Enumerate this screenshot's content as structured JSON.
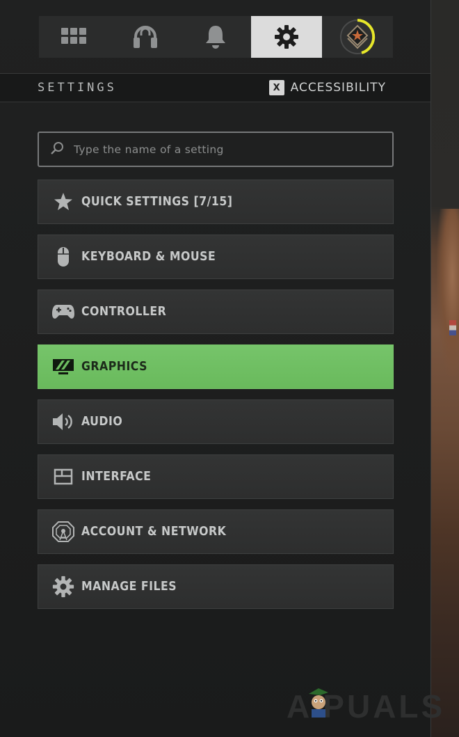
{
  "top_nav": {
    "items": [
      {
        "name": "grid-menu",
        "icon": "grid-icon"
      },
      {
        "name": "social",
        "icon": "headset-icon"
      },
      {
        "name": "notifications",
        "icon": "bell-icon"
      },
      {
        "name": "settings",
        "icon": "gear-icon",
        "active": true
      },
      {
        "name": "profile",
        "icon": "rank-badge-icon"
      }
    ]
  },
  "header": {
    "title": "SETTINGS",
    "accessibility_key": "X",
    "accessibility_label": "ACCESSIBILITY"
  },
  "search": {
    "placeholder": "Type the name of a setting",
    "value": ""
  },
  "menu": {
    "items": [
      {
        "label": "QUICK SETTINGS [7/15]",
        "icon": "star-icon"
      },
      {
        "label": "KEYBOARD & MOUSE",
        "icon": "mouse-icon"
      },
      {
        "label": "CONTROLLER",
        "icon": "gamepad-icon"
      },
      {
        "label": "GRAPHICS",
        "icon": "monitor-icon",
        "active": true
      },
      {
        "label": "AUDIO",
        "icon": "speaker-icon"
      },
      {
        "label": "INTERFACE",
        "icon": "layout-icon"
      },
      {
        "label": "ACCOUNT & NETWORK",
        "icon": "network-icon"
      },
      {
        "label": "MANAGE FILES",
        "icon": "gear-icon"
      }
    ]
  },
  "watermark": "A  PUALS",
  "colors": {
    "active_green": "#6dbd60",
    "rank_ring": "#e6e62a"
  }
}
